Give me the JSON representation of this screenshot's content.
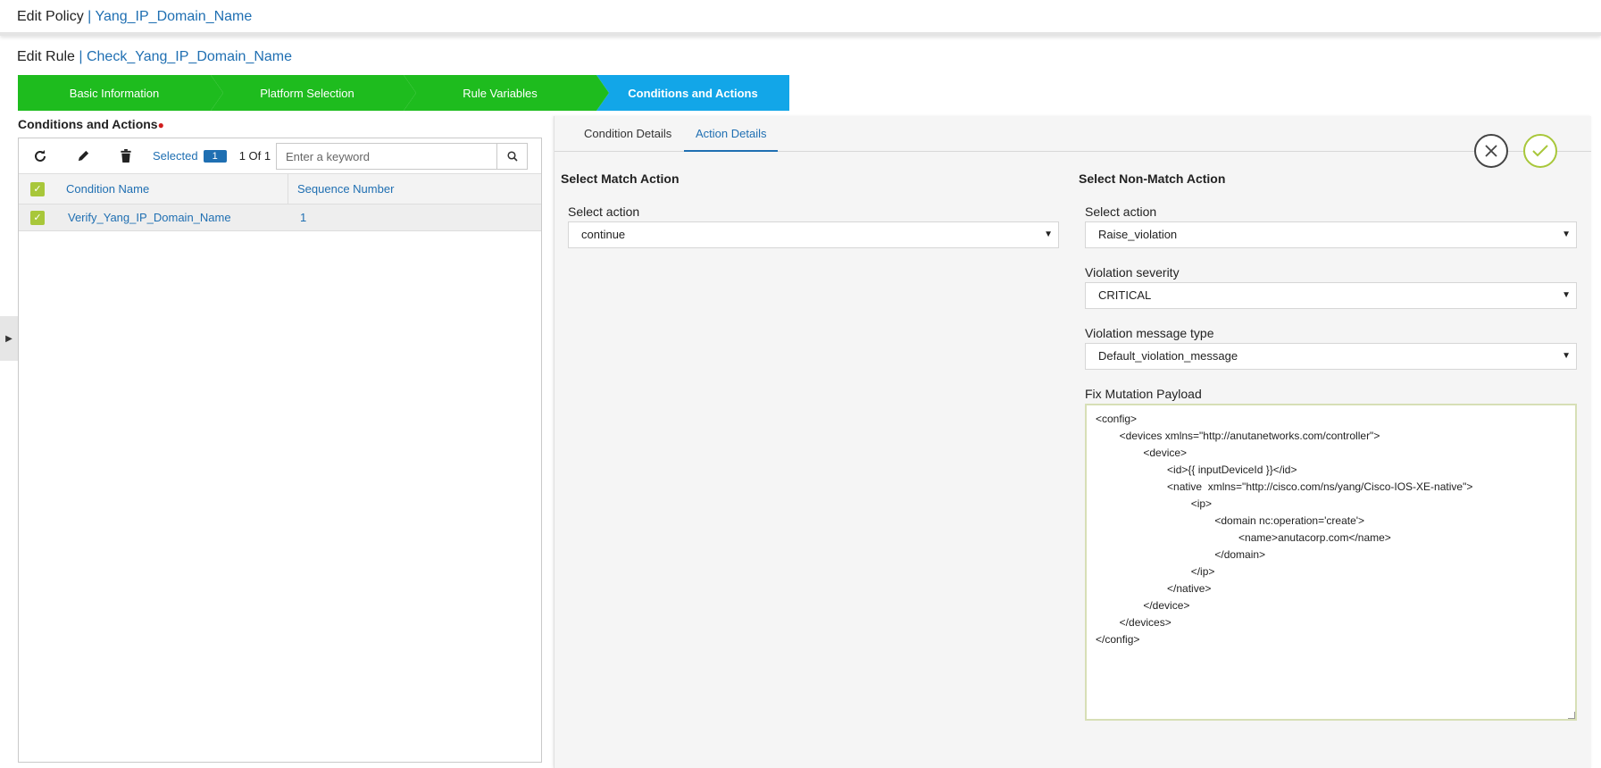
{
  "header": {
    "prefix": "Edit Policy",
    "separator": " | ",
    "policy_name": "Yang_IP_Domain_Name"
  },
  "rule": {
    "prefix": "Edit Rule",
    "separator": " | ",
    "rule_name": "Check_Yang_IP_Domain_Name"
  },
  "wizard": {
    "steps": [
      {
        "label": "Basic Information"
      },
      {
        "label": "Platform Selection"
      },
      {
        "label": "Rule Variables"
      },
      {
        "label": "Conditions and Actions"
      }
    ],
    "active_index": 3
  },
  "conditions": {
    "label": "Conditions and Actions",
    "required_marker": "●",
    "toolbar": {
      "refresh_icon": "refresh-icon",
      "edit_icon": "edit-pencil-icon",
      "delete_icon": "trash-icon",
      "selected_label": "Selected",
      "selected_count": "1",
      "page_count": "1 Of 1",
      "search_placeholder": "Enter a keyword",
      "search_icon": "search-icon"
    },
    "columns": {
      "name": "Condition Name",
      "sequence": "Sequence Number"
    },
    "rows": [
      {
        "name": "Verify_Yang_IP_Domain_Name",
        "sequence": "1",
        "checked": true
      }
    ]
  },
  "detail": {
    "tabs": [
      {
        "label": "Condition Details"
      },
      {
        "label": "Action Details"
      }
    ],
    "active_tab": 1,
    "close_icon": "close-icon",
    "confirm_icon": "check-icon",
    "match": {
      "title": "Select Match Action",
      "action_label": "Select action",
      "action_value": "continue"
    },
    "non_match": {
      "title": "Select Non-Match Action",
      "action_label": "Select action",
      "action_value": "Raise_violation",
      "severity_label": "Violation severity",
      "severity_value": "CRITICAL",
      "message_type_label": "Violation message type",
      "message_type_value": "Default_violation_message",
      "payload_label": "Fix Mutation Payload",
      "payload_value": "<config>\n        <devices xmlns=\"http://anutanetworks.com/controller\">\n                <device>\n                        <id>{{ inputDeviceId }}</id>\n                        <native  xmlns=\"http://cisco.com/ns/yang/Cisco-IOS-XE-native\">\n                                <ip>\n                                        <domain nc:operation='create'>\n                                                <name>anutacorp.com</name>\n                                        </domain>\n                                </ip>\n                        </native>\n                </device>\n        </devices>\n</config>"
    }
  },
  "colors": {
    "step_complete": "#1ebc1e",
    "step_active": "#12a6e8",
    "link": "#1f6fb2",
    "checkbox": "#a8c73a"
  }
}
